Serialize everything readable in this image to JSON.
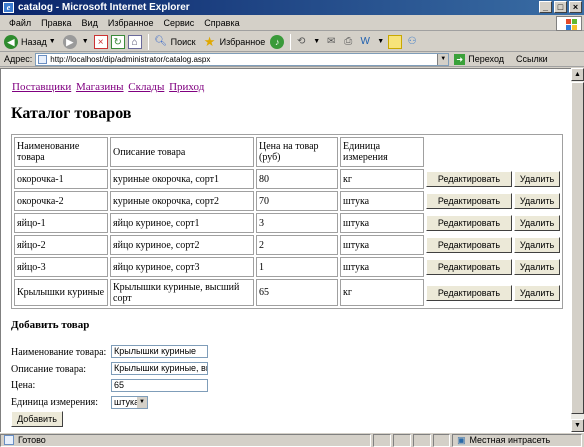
{
  "window": {
    "title": "catalog - Microsoft Internet Explorer",
    "minimize": "_",
    "maximize": "□",
    "close": "×"
  },
  "menu": [
    "Файл",
    "Правка",
    "Вид",
    "Избранное",
    "Сервис",
    "Справка"
  ],
  "toolbar": {
    "back": "Назад",
    "search": "Поиск",
    "favorites": "Избранное"
  },
  "address": {
    "label": "Адрес:",
    "url": "http://localhost/dip/administrator/catalog.aspx",
    "go": "Переход",
    "links": "Ссылки"
  },
  "page": {
    "nav": [
      "Поставщики",
      "Магазины",
      "Склады",
      "Приход"
    ],
    "title": "Каталог товаров",
    "table": {
      "headers": [
        "Наименование товара",
        "Описание товара",
        "Цена на товар (руб)",
        "Единица измерения"
      ],
      "edit_label": "Редактировать",
      "delete_label": "Удалить",
      "rows": [
        {
          "name": "окорочка-1",
          "description": "куриные окорочка, сорт1",
          "price": "80",
          "unit": "кг"
        },
        {
          "name": "окорочка-2",
          "description": "куриные окорочка, сорт2",
          "price": "70",
          "unit": "штука"
        },
        {
          "name": "яйцо-1",
          "description": "яйцо куриное, сорт1",
          "price": "3",
          "unit": "штука"
        },
        {
          "name": "яйцо-2",
          "description": "яйцо куриное, сорт2",
          "price": "2",
          "unit": "штука"
        },
        {
          "name": "яйцо-3",
          "description": "яйцо куриное, сорт3",
          "price": "1",
          "unit": "штука"
        },
        {
          "name": "Крылышки куриные",
          "description": "Крылышки куриные, высший сорт",
          "price": "65",
          "unit": "кг"
        }
      ]
    },
    "add_form": {
      "heading": "Добавить товар",
      "name_label": "Наименование товара:",
      "name_value": "Крылышки куриные",
      "description_label": "Описание товара:",
      "description_value": "Крылышки куриные, высш",
      "price_label": "Цена:",
      "price_value": "65",
      "unit_label": "Единица измерения:",
      "unit_value": "штука",
      "submit_label": "Добавить"
    }
  },
  "status": {
    "text": "Готово",
    "zone": "Местная интрасеть"
  },
  "colors": {
    "titlebar_start": "#0a246a",
    "titlebar_end": "#3a6ea5",
    "visited_link": "#800080",
    "chrome": "#d4d0c8"
  }
}
